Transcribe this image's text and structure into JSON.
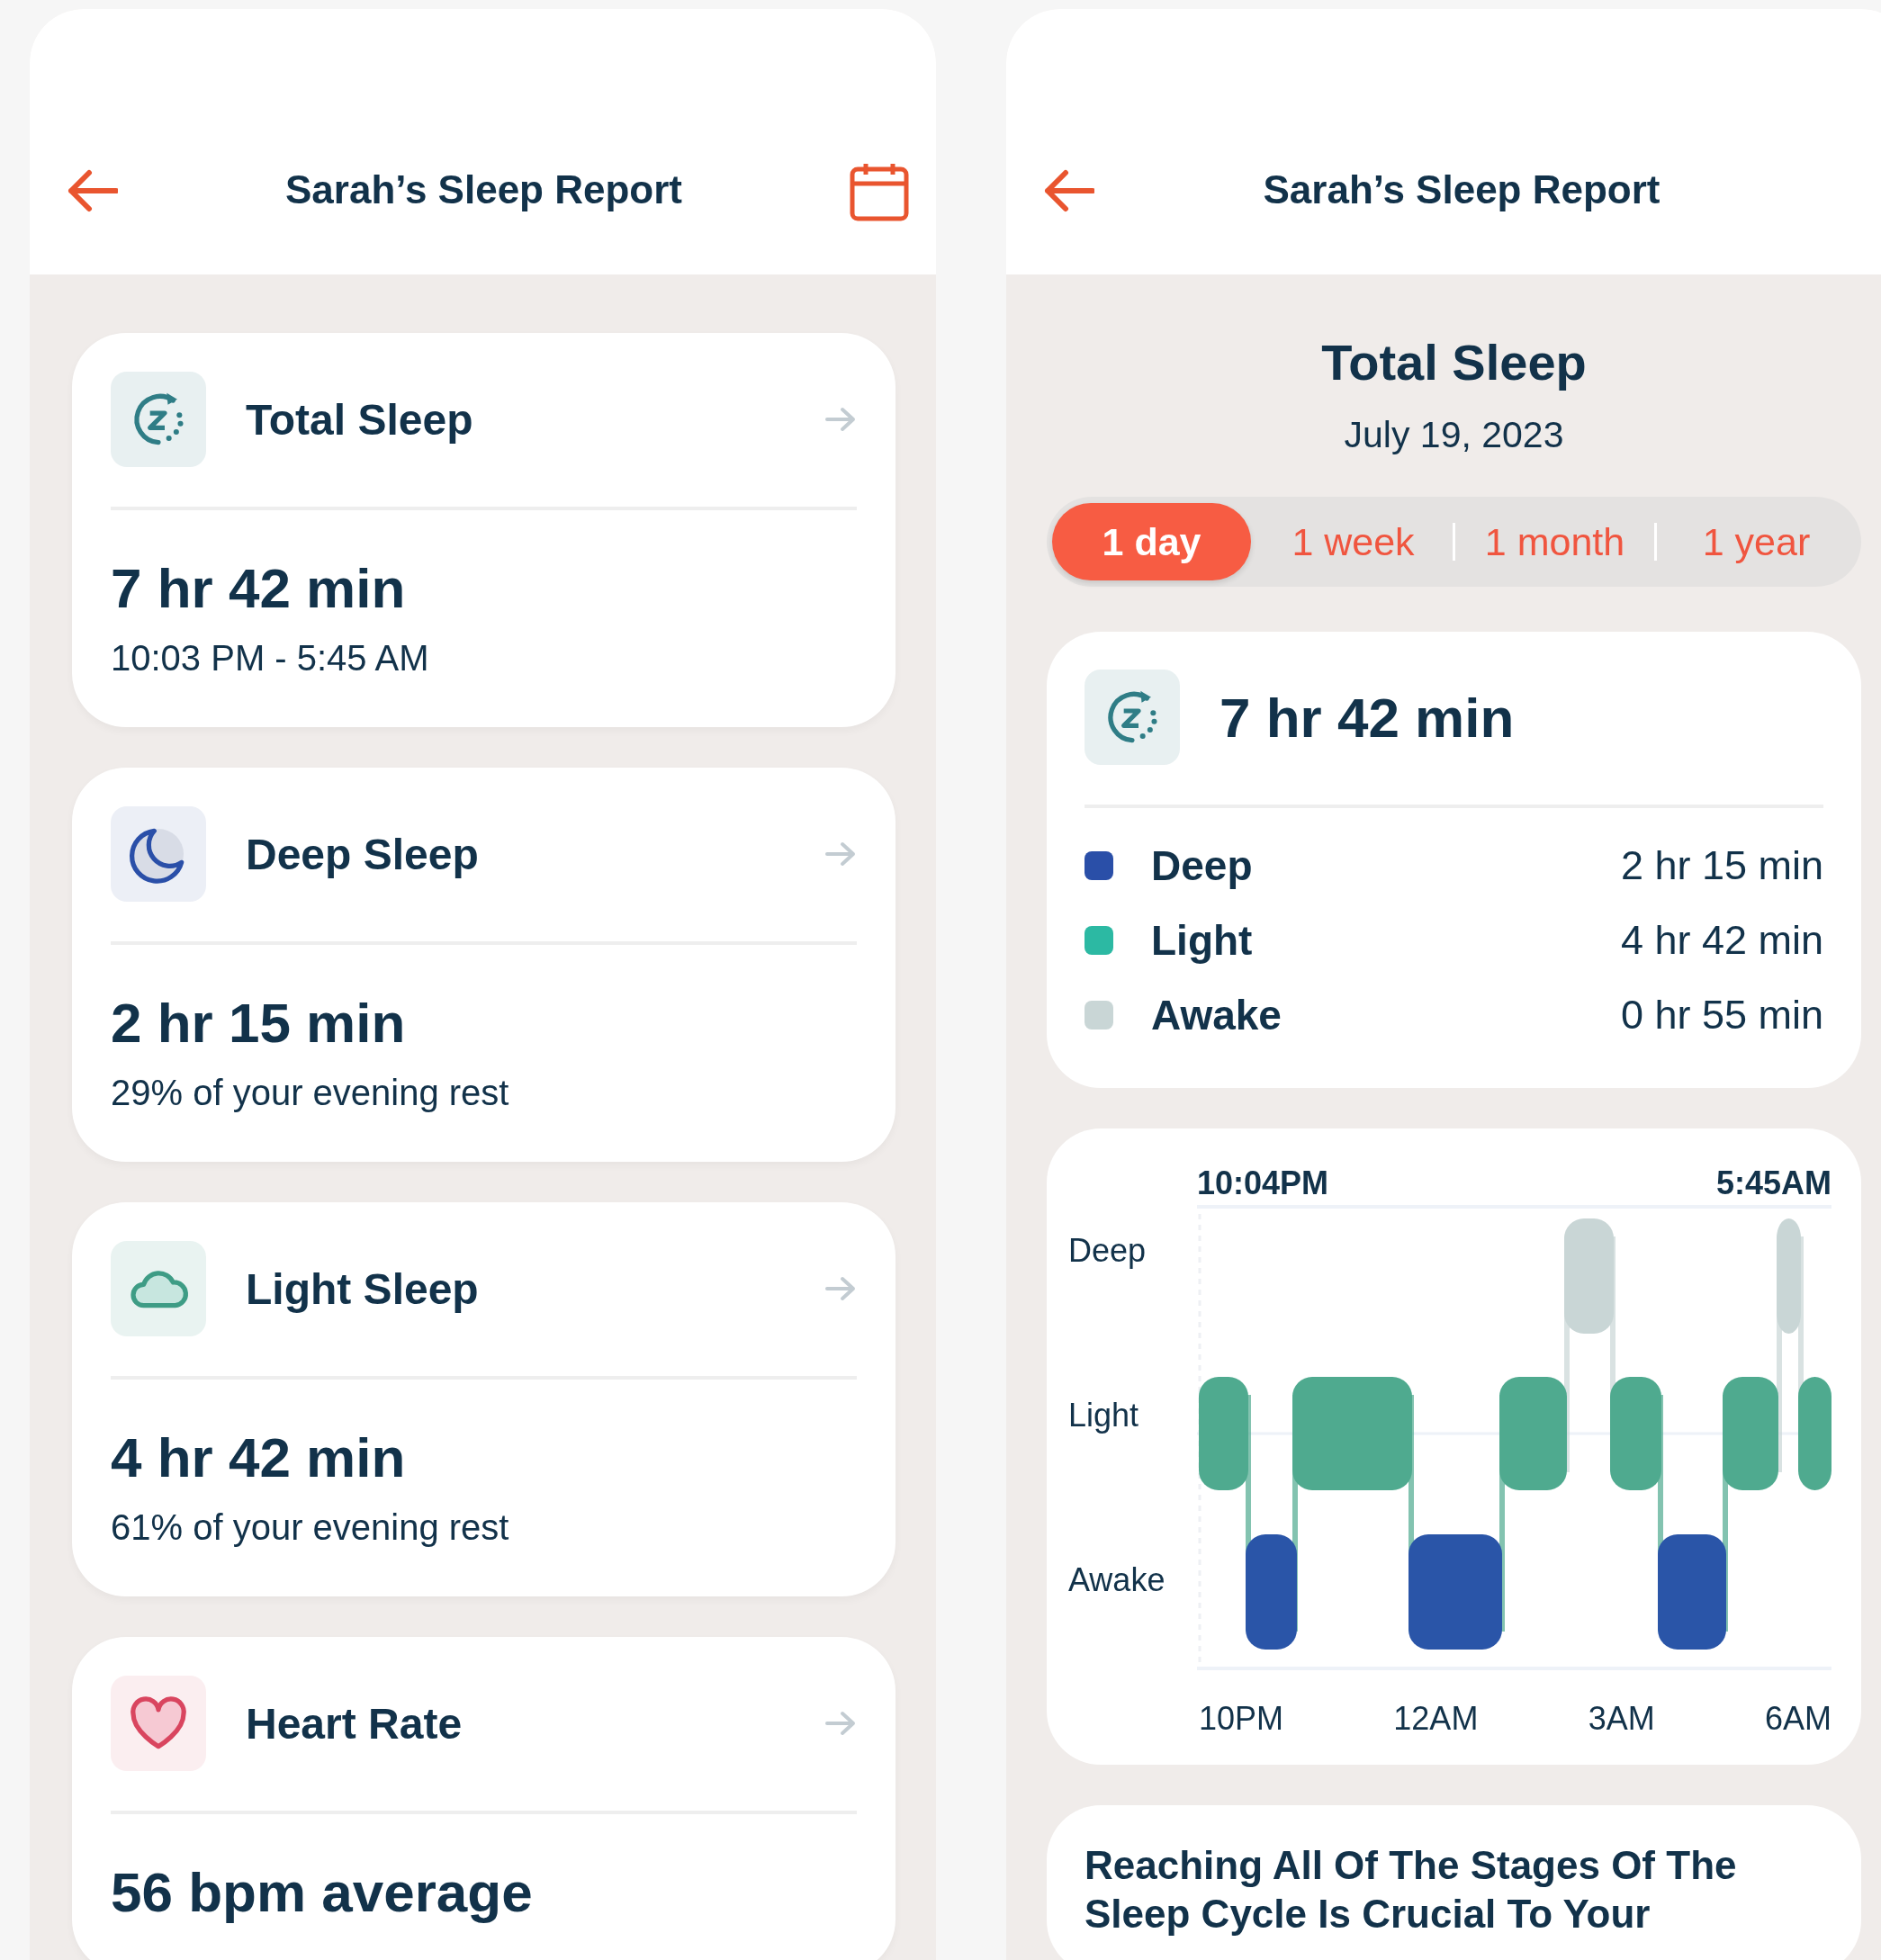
{
  "left_screen": {
    "header": {
      "title": "Sarah’s Sleep Report"
    },
    "cards": [
      {
        "kind": "total",
        "title": "Total Sleep",
        "value": "7 hr 42 min",
        "detail": "10:03 PM - 5:45 AM"
      },
      {
        "kind": "deep",
        "title": "Deep Sleep",
        "value": "2 hr 15 min",
        "detail": "29% of your evening rest"
      },
      {
        "kind": "light",
        "title": "Light Sleep",
        "value": "4 hr 42 min",
        "detail": "61% of your evening rest"
      },
      {
        "kind": "heart",
        "title": "Heart Rate",
        "value": "56 bpm average"
      }
    ]
  },
  "right_screen": {
    "header": {
      "title": "Sarah’s Sleep Report"
    },
    "heading": "Total Sleep",
    "date": "July 19, 2023",
    "ranges": [
      {
        "label": "1 day",
        "selected": true
      },
      {
        "label": "1 week",
        "selected": false
      },
      {
        "label": "1 month",
        "selected": false
      },
      {
        "label": "1 year",
        "selected": false
      }
    ],
    "summary": {
      "total": "7 hr 42 min",
      "stages": [
        {
          "name": "Deep",
          "duration": "2 hr 15 min",
          "color": "#2a4fa8"
        },
        {
          "name": "Light",
          "duration": "4 hr 42 min",
          "color": "#2cb9a3"
        },
        {
          "name": "Awake",
          "duration": "0 hr 55 min",
          "color": "#c9d6d6"
        }
      ]
    },
    "hypnogram": {
      "start_time": "10:04PM",
      "end_time": "5:45AM",
      "y_labels": [
        "Deep",
        "Light",
        "Awake"
      ],
      "x_labels": [
        "10PM",
        "12AM",
        "3AM",
        "6AM"
      ]
    },
    "article": {
      "title": "Reaching All Of The Stages Of The Sleep Cycle Is Crucial To Your"
    }
  }
}
